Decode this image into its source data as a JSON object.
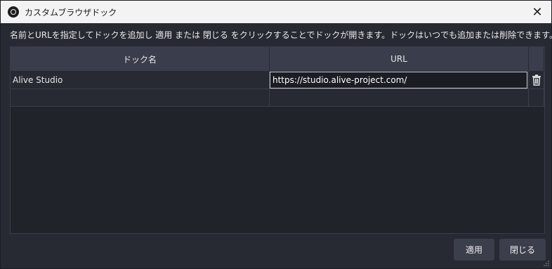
{
  "window": {
    "title": "カスタムブラウザドック",
    "close_glyph": "✕"
  },
  "instruction": "名前とURLを指定してドックを追加し 適用 または 閉じる をクリックすることでドックが開きます。ドックはいつでも追加または削除できます。",
  "table": {
    "columns": [
      "ドック名",
      "URL"
    ],
    "rows": [
      {
        "name": "Alive Studio",
        "url": "https://studio.alive-project.com/"
      },
      {
        "name": "",
        "url": ""
      }
    ],
    "row_delete_icon": "trash-icon"
  },
  "buttons": {
    "apply": "適用",
    "close": "閉じる"
  },
  "colors": {
    "background": "#272a33",
    "header": "#3a3e4c",
    "button": "#3b3e4b",
    "titlebar": "#f3f3f3"
  }
}
